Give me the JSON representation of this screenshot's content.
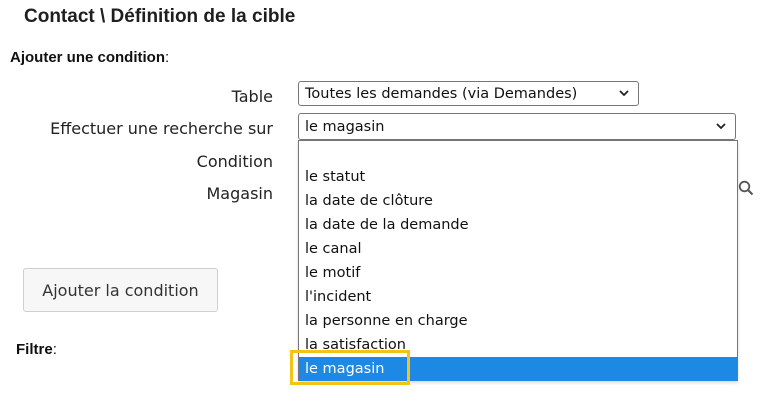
{
  "page": {
    "title": "Contact \\ Définition de la cible"
  },
  "add_condition": {
    "heading": "Ajouter une condition",
    "heading_colon": ":"
  },
  "form": {
    "table_label": "Table",
    "table_value": "Toutes les demandes (via Demandes)",
    "search_on_label": "Effectuer une recherche sur",
    "search_on_value": "le magasin",
    "condition_label": "Condition",
    "store_label": "Magasin"
  },
  "dropdown": {
    "options": [
      {
        "label": ""
      },
      {
        "label": "le statut"
      },
      {
        "label": "la date de clôture"
      },
      {
        "label": "la date de la demande"
      },
      {
        "label": "le canal"
      },
      {
        "label": "le motif"
      },
      {
        "label": "l'incident"
      },
      {
        "label": "la personne en charge"
      },
      {
        "label": "la satisfaction"
      },
      {
        "label": "le magasin"
      }
    ],
    "selected_index": 9
  },
  "buttons": {
    "add_condition": "Ajouter la condition"
  },
  "filter": {
    "heading": "Filtre",
    "heading_colon": ":"
  },
  "icons": {
    "dropdown_arrow": "chevron-down-icon",
    "search": "search-icon"
  },
  "colors": {
    "selected_option_bg": "#1e88e5",
    "highlight_border": "#f2c417"
  }
}
